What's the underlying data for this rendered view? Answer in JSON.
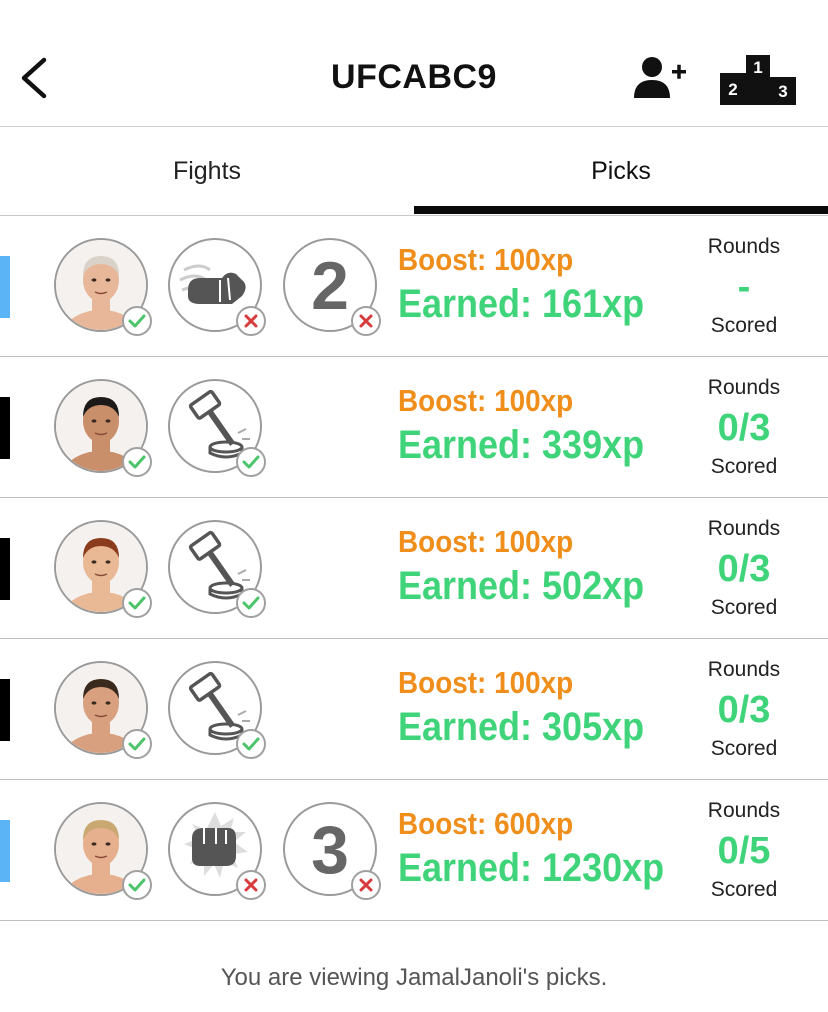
{
  "header": {
    "title": "UFCABC9",
    "leaderboard_ranks": [
      "1",
      "2",
      "3"
    ]
  },
  "tabs": [
    {
      "label": "Fights",
      "active": false
    },
    {
      "label": "Picks",
      "active": true
    }
  ],
  "colors": {
    "boost": "#f08e1c",
    "earned": "#3fd47a",
    "correct": "#4cc46a",
    "incorrect": "#d83b3b",
    "indicator_blue": "#5ab4f5",
    "indicator_black": "#000000"
  },
  "picks": [
    {
      "indicator": "blue",
      "fighter_result": "correct",
      "method_icon": "glove-punch-icon",
      "method_result": "incorrect",
      "round": "2",
      "round_result": "incorrect",
      "boost": "Boost: 100xp",
      "earned": "Earned: 161xp",
      "rounds_label": "Rounds",
      "rounds_value": "-",
      "scored_label": "Scored"
    },
    {
      "indicator": "black",
      "fighter_result": "correct",
      "method_icon": "gavel-icon",
      "method_result": "correct",
      "boost": "Boost: 100xp",
      "earned": "Earned: 339xp",
      "rounds_label": "Rounds",
      "rounds_value": "0/3",
      "scored_label": "Scored"
    },
    {
      "indicator": "black",
      "fighter_result": "correct",
      "method_icon": "gavel-icon",
      "method_result": "correct",
      "boost": "Boost: 100xp",
      "earned": "Earned: 502xp",
      "rounds_label": "Rounds",
      "rounds_value": "0/3",
      "scored_label": "Scored"
    },
    {
      "indicator": "black",
      "fighter_result": "correct",
      "method_icon": "gavel-icon",
      "method_result": "correct",
      "boost": "Boost: 100xp",
      "earned": "Earned: 305xp",
      "rounds_label": "Rounds",
      "rounds_value": "0/3",
      "scored_label": "Scored"
    },
    {
      "indicator": "blue",
      "fighter_result": "correct",
      "method_icon": "fist-impact-icon",
      "method_result": "incorrect",
      "round": "3",
      "round_result": "incorrect",
      "boost": "Boost: 600xp",
      "earned": "Earned: 1230xp",
      "rounds_label": "Rounds",
      "rounds_value": "0/5",
      "scored_label": "Scored"
    }
  ],
  "footer": {
    "text": "You are viewing JamalJanoli's picks."
  }
}
